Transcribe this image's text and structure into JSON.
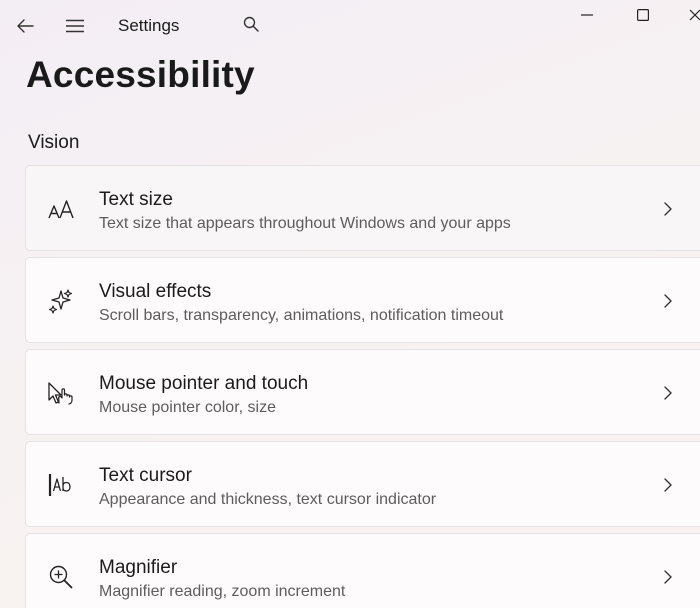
{
  "titlebar": {
    "app_title": "Settings"
  },
  "page": {
    "title": "Accessibility",
    "section": "Vision"
  },
  "items": [
    {
      "title": "Text size",
      "subtitle": "Text size that appears throughout Windows and your apps",
      "icon": "text-size-icon"
    },
    {
      "title": "Visual effects",
      "subtitle": "Scroll bars, transparency, animations, notification timeout",
      "icon": "sparkle-icon"
    },
    {
      "title": "Mouse pointer and touch",
      "subtitle": "Mouse pointer color, size",
      "icon": "pointer-hand-icon"
    },
    {
      "title": "Text cursor",
      "subtitle": "Appearance and thickness, text cursor indicator",
      "icon": "text-cursor-icon"
    },
    {
      "title": "Magnifier",
      "subtitle": "Magnifier reading, zoom increment",
      "icon": "magnifier-icon"
    }
  ]
}
